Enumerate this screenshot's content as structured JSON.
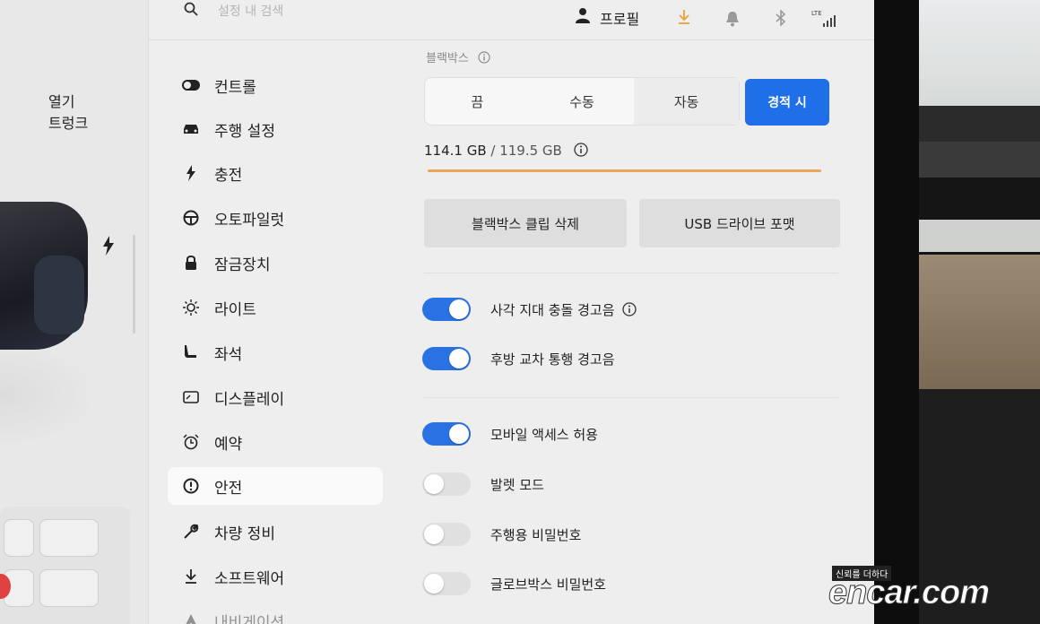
{
  "topbar": {
    "search_placeholder": "설정 내 검색",
    "profile_label": "프로필",
    "network_label": "LTE"
  },
  "car": {
    "open_label": "열기",
    "trunk_label": "트렁크"
  },
  "menu": {
    "items": [
      {
        "label": "컨트롤",
        "icon": "toggle-icon"
      },
      {
        "label": "주행 설정",
        "icon": "car-icon"
      },
      {
        "label": "충전",
        "icon": "bolt-icon"
      },
      {
        "label": "오토파일럿",
        "icon": "steering-wheel-icon"
      },
      {
        "label": "잠금장치",
        "icon": "lock-icon"
      },
      {
        "label": "라이트",
        "icon": "sun-icon"
      },
      {
        "label": "좌석",
        "icon": "seat-icon"
      },
      {
        "label": "디스플레이",
        "icon": "display-icon"
      },
      {
        "label": "예약",
        "icon": "alarm-clock-icon"
      },
      {
        "label": "안전",
        "icon": "alert-circle-icon",
        "active": true
      },
      {
        "label": "차량 정비",
        "icon": "wrench-icon"
      },
      {
        "label": "소프트웨어",
        "icon": "download-icon"
      },
      {
        "label": "내비게이션",
        "icon": "navigation-icon"
      }
    ]
  },
  "dashcam": {
    "title": "블랙박스",
    "options": [
      "끔",
      "수동",
      "자동"
    ],
    "selected": "자동",
    "sentry_label": "경적 시",
    "storage_used": "114.1 GB",
    "storage_sep": " / ",
    "storage_total": "119.5 GB",
    "storage_fraction": 0.955,
    "delete_clips_label": "블랙박스 클립 삭제",
    "format_usb_label": "USB 드라이브 포맷"
  },
  "toggles": [
    {
      "label": "사각 지대 충돌 경고음",
      "on": true,
      "info": true
    },
    {
      "label": "후방 교차 통행 경고음",
      "on": true,
      "info": false
    },
    {
      "label": "모바일 액세스 허용",
      "on": true,
      "info": false
    },
    {
      "label": "발렛 모드",
      "on": false,
      "info": false
    },
    {
      "label": "주행용 비밀번호",
      "on": false,
      "info": false
    },
    {
      "label": "글로브박스 비밀번호",
      "on": false,
      "info": false
    }
  ],
  "watermark": {
    "tagline": "신뢰를 더하다",
    "logo": "encar.com"
  },
  "colors": {
    "accent": "#2a72e4",
    "sentry_button": "#1f6fe8",
    "storage_bar": "#e9a75a",
    "download_indicator": "#e8a13c"
  }
}
